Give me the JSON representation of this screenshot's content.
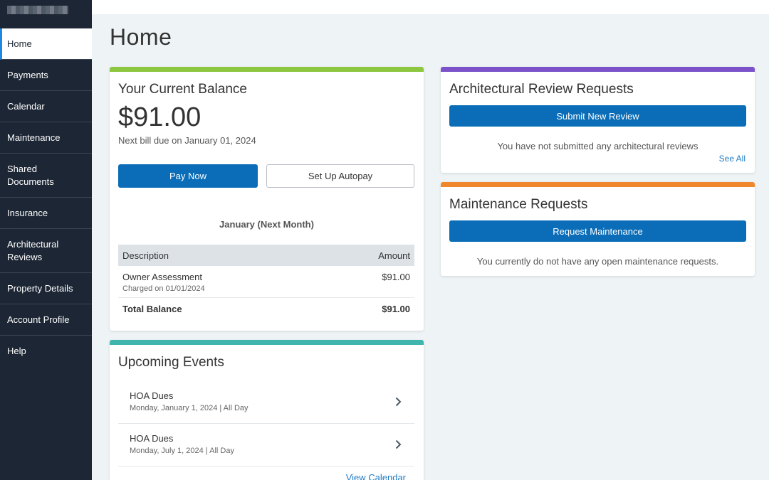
{
  "sidebar": {
    "items": [
      {
        "label": "Home",
        "active": true
      },
      {
        "label": "Payments"
      },
      {
        "label": "Calendar"
      },
      {
        "label": "Maintenance"
      },
      {
        "label": "Shared Documents"
      },
      {
        "label": "Insurance"
      },
      {
        "label": "Architectural Reviews"
      },
      {
        "label": "Property Details"
      },
      {
        "label": "Account Profile"
      },
      {
        "label": "Help"
      }
    ]
  },
  "page": {
    "title": "Home"
  },
  "balance": {
    "title": "Your Current Balance",
    "amount": "$91.00",
    "due": "Next bill due on January 01, 2024",
    "pay_label": "Pay Now",
    "autopay_label": "Set Up Autopay",
    "period": "January (Next Month)",
    "columns": [
      "Description",
      "Amount"
    ],
    "rows": [
      {
        "description": "Owner Assessment",
        "sub": "Charged on 01/01/2024",
        "amount": "$91.00"
      }
    ],
    "total_label": "Total Balance",
    "total_amount": "$91.00",
    "accent": "#8dc63f"
  },
  "events": {
    "title": "Upcoming Events",
    "items": [
      {
        "name": "HOA Dues",
        "date": "Monday, January 1, 2024 | All Day"
      },
      {
        "name": "HOA Dues",
        "date": "Monday, July 1, 2024 | All Day"
      }
    ],
    "view_calendar": "View Calendar",
    "accent": "#3fb5ad"
  },
  "arch": {
    "title": "Architectural Review Requests",
    "button": "Submit New Review",
    "empty": "You have not submitted any architectural reviews",
    "see_all": "See All",
    "accent": "#7b52c9"
  },
  "maint": {
    "title": "Maintenance Requests",
    "button": "Request Maintenance",
    "empty": "You currently do not have any open maintenance requests.",
    "accent": "#f0872d"
  }
}
